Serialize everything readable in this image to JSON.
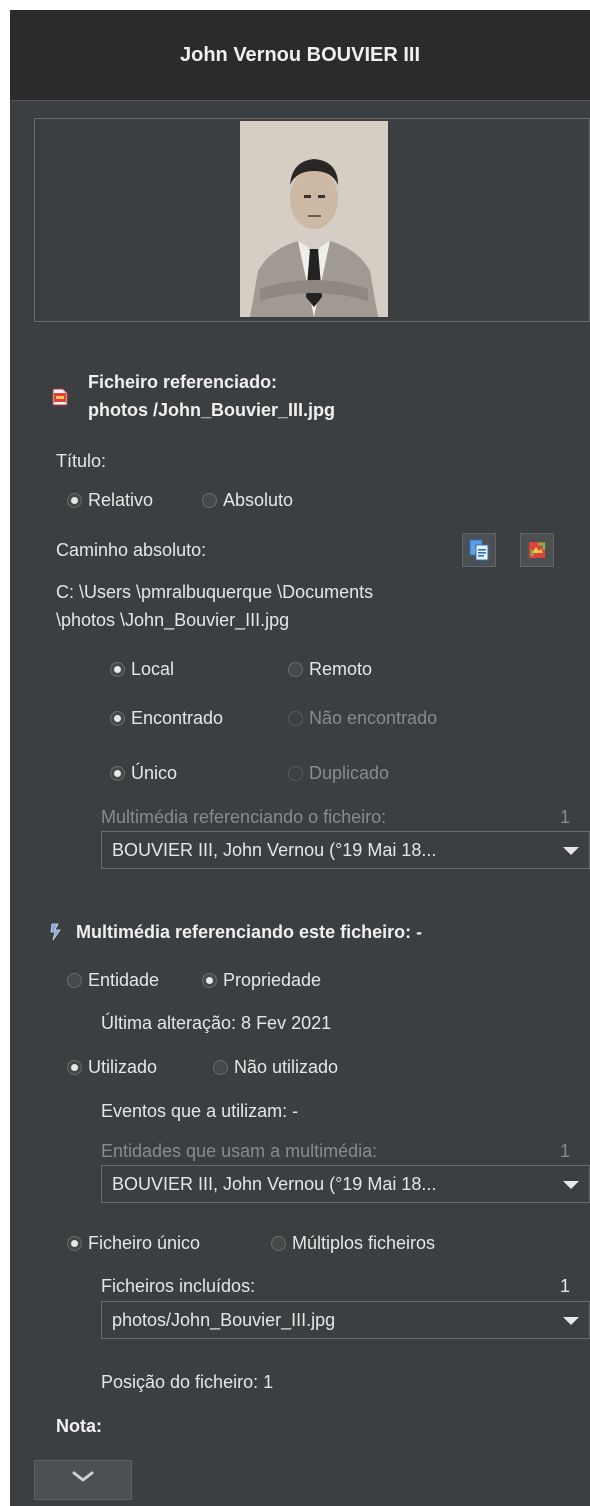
{
  "header": {
    "title": "John Vernou BOUVIER III"
  },
  "file": {
    "heading_line1": "Ficheiro referenciado:",
    "heading_line2": "photos /John_Bouvier_III.jpg",
    "title_label": "Título:",
    "path_mode": {
      "relative": "Relativo",
      "absolute": "Absoluto",
      "selected": "Relativo"
    },
    "absolute_path_label": "Caminho absoluto:",
    "absolute_path_line1": "C: \\Users \\pmralbuquerque \\Documents",
    "absolute_path_line2": "\\photos \\John_Bouvier_III.jpg",
    "location": {
      "local": "Local",
      "remote": "Remoto",
      "selected": "Local"
    },
    "found": {
      "found": "Encontrado",
      "not_found": "Não encontrado",
      "selected": "Encontrado"
    },
    "uniqueness": {
      "unique": "Único",
      "duplicate": "Duplicado",
      "selected": "Único"
    },
    "referencing_label": "Multimédia referenciando o ficheiro:",
    "referencing_count": "1",
    "referencing_selected": "BOUVIER III, John Vernou (°19 Mai 18..."
  },
  "media": {
    "heading": "Multimédia referenciando este ficheiro: -",
    "type": {
      "entity": "Entidade",
      "property": "Propriedade",
      "selected": "Propriedade"
    },
    "last_change": "Última alteração: 8 Fev 2021",
    "usage": {
      "used": "Utilizado",
      "unused": "Não utilizado",
      "selected": "Utilizado"
    },
    "events": "Eventos que a utilizam: -",
    "entities_label": "Entidades que usam a multimédia:",
    "entities_count": "1",
    "entities_selected": "BOUVIER III, John Vernou (°19 Mai 18...",
    "files_mode": {
      "single": "Ficheiro único",
      "multiple": "Múltiplos ficheiros",
      "selected": "Ficheiro único"
    },
    "included_label": "Ficheiros incluídos:",
    "included_count": "1",
    "included_selected": "photos/John_Bouvier_III.jpg",
    "position": "Posição do ficheiro: 1"
  },
  "note_label": "Nota:",
  "icons": {
    "file": "image-file-icon",
    "copy": "copy-path-icon",
    "replace": "replace-file-icon",
    "media": "media-link-icon",
    "expand": "chevron-down-icon"
  },
  "colors": {
    "panel": "#3c3f41",
    "header": "#2b2b2b",
    "text": "#e6e6e6",
    "disabled_text": "#8a8a8a"
  }
}
